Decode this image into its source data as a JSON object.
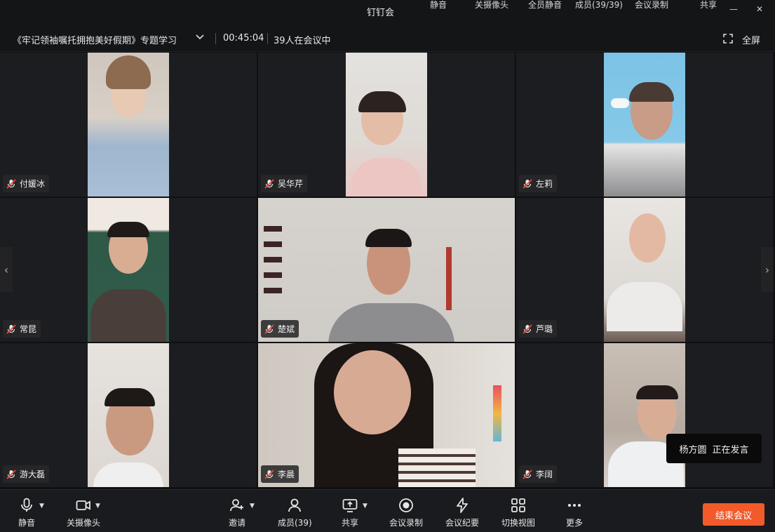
{
  "app": {
    "name": "钉钉会",
    "top_items": [
      "静音",
      "关摄像头",
      "全员静音",
      "成员(39/39)",
      "会议录制",
      "共享"
    ]
  },
  "meeting": {
    "title": "《牢记领袖嘱托拥抱美好假期》专题学习",
    "timer": "00:45:04",
    "participant_count": "39人在会议中",
    "fullscreen_label": "全屏"
  },
  "participants": [
    {
      "name": "付媛冰",
      "muted": true
    },
    {
      "name": "吴华芹",
      "muted": true
    },
    {
      "name": "左莉",
      "muted": true
    },
    {
      "name": "常昆",
      "muted": true
    },
    {
      "name": "楚斌",
      "muted": true
    },
    {
      "name": "芦璐",
      "muted": true
    },
    {
      "name": "游大磊",
      "muted": true
    },
    {
      "name": "李晨",
      "muted": true
    },
    {
      "name": "李阔",
      "muted": true
    }
  ],
  "speaker": {
    "name": "杨方圆",
    "status": "正在发言"
  },
  "toolbar": {
    "mute": "静音",
    "camera": "关摄像头",
    "invite": "邀请",
    "members": "成员(39)",
    "share": "共享",
    "record": "会议录制",
    "minutes": "会议纪要",
    "view": "切换视图",
    "more": "更多",
    "end": "结束会议"
  },
  "colors": {
    "end_button": "#f25a2b",
    "background": "#0f1012"
  }
}
